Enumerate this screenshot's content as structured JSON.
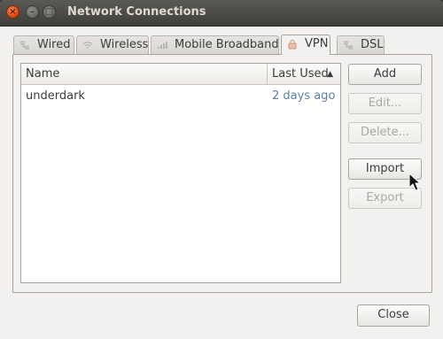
{
  "window": {
    "title": "Network Connections"
  },
  "titlebar_buttons": {
    "close": "×",
    "minimize": "–",
    "maximize": "□"
  },
  "tabs": [
    {
      "label": "Wired",
      "icon": "wired-icon"
    },
    {
      "label": "Wireless",
      "icon": "wireless-icon"
    },
    {
      "label": "Mobile Broadband",
      "icon": "mobile-broadband-icon"
    },
    {
      "label": "VPN",
      "icon": "vpn-lock-icon",
      "active": true
    },
    {
      "label": "DSL",
      "icon": "dsl-icon"
    }
  ],
  "list": {
    "columns": {
      "name": "Name",
      "last_used": "Last Used",
      "sort_indicator": "▲"
    },
    "rows": [
      {
        "name": "underdark",
        "last_used": "2 days ago"
      }
    ]
  },
  "buttons": {
    "add": "Add",
    "edit": "Edit...",
    "delete": "Delete...",
    "import": "Import",
    "export": "Export",
    "close": "Close"
  },
  "colors": {
    "titlebar": "#4a4945",
    "window_bg": "#f2f1f0",
    "close_button": "#df4a14",
    "timestamp_text": "#5c7fa8"
  }
}
